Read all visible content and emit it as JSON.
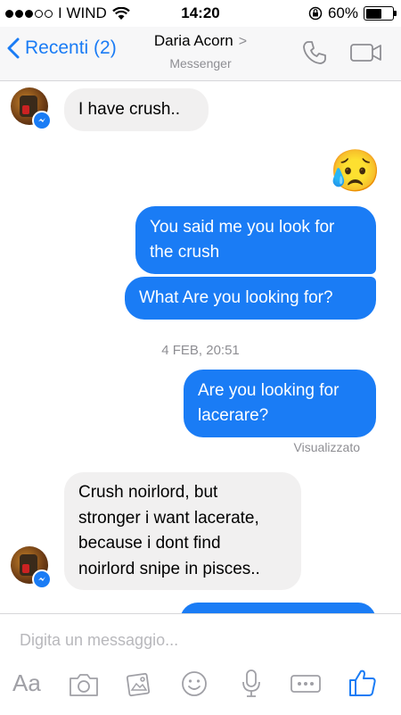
{
  "status_bar": {
    "carrier": "I WIND",
    "time": "14:20",
    "battery_text": "60%",
    "battery_level": 0.6
  },
  "header": {
    "back_label": "Recenti (2)",
    "contact_name": "Daria Acorn",
    "subtitle": "Messenger",
    "chevron": ">",
    "icons": [
      "phone-icon",
      "video-camera-icon"
    ]
  },
  "messages": {
    "m1": "I have crush..",
    "m2_emoji": "😥",
    "m3": [
      "You said me you look for",
      "the crush"
    ],
    "m4": "What Are you looking for?",
    "timestamp": "4 FEB, 20:51",
    "m5": [
      "Are you looking for",
      "lacerare?"
    ],
    "seen": "Visualizzato",
    "m6": [
      "Crush noirlord, but",
      "stronger i want lacerate,",
      "because i dont find",
      "noirlord snipe in pisces.."
    ]
  },
  "composer": {
    "placeholder": "Digita un messaggio...",
    "aa_label": "Aa",
    "icons": [
      "text-format-icon",
      "camera-icon",
      "gallery-icon",
      "emoji-icon",
      "microphone-icon",
      "more-icon",
      "like-icon"
    ]
  },
  "colors": {
    "accent": "#1a7cf5",
    "incoming_bubble": "#f1f0f0",
    "meta_text": "#8e8e93"
  }
}
